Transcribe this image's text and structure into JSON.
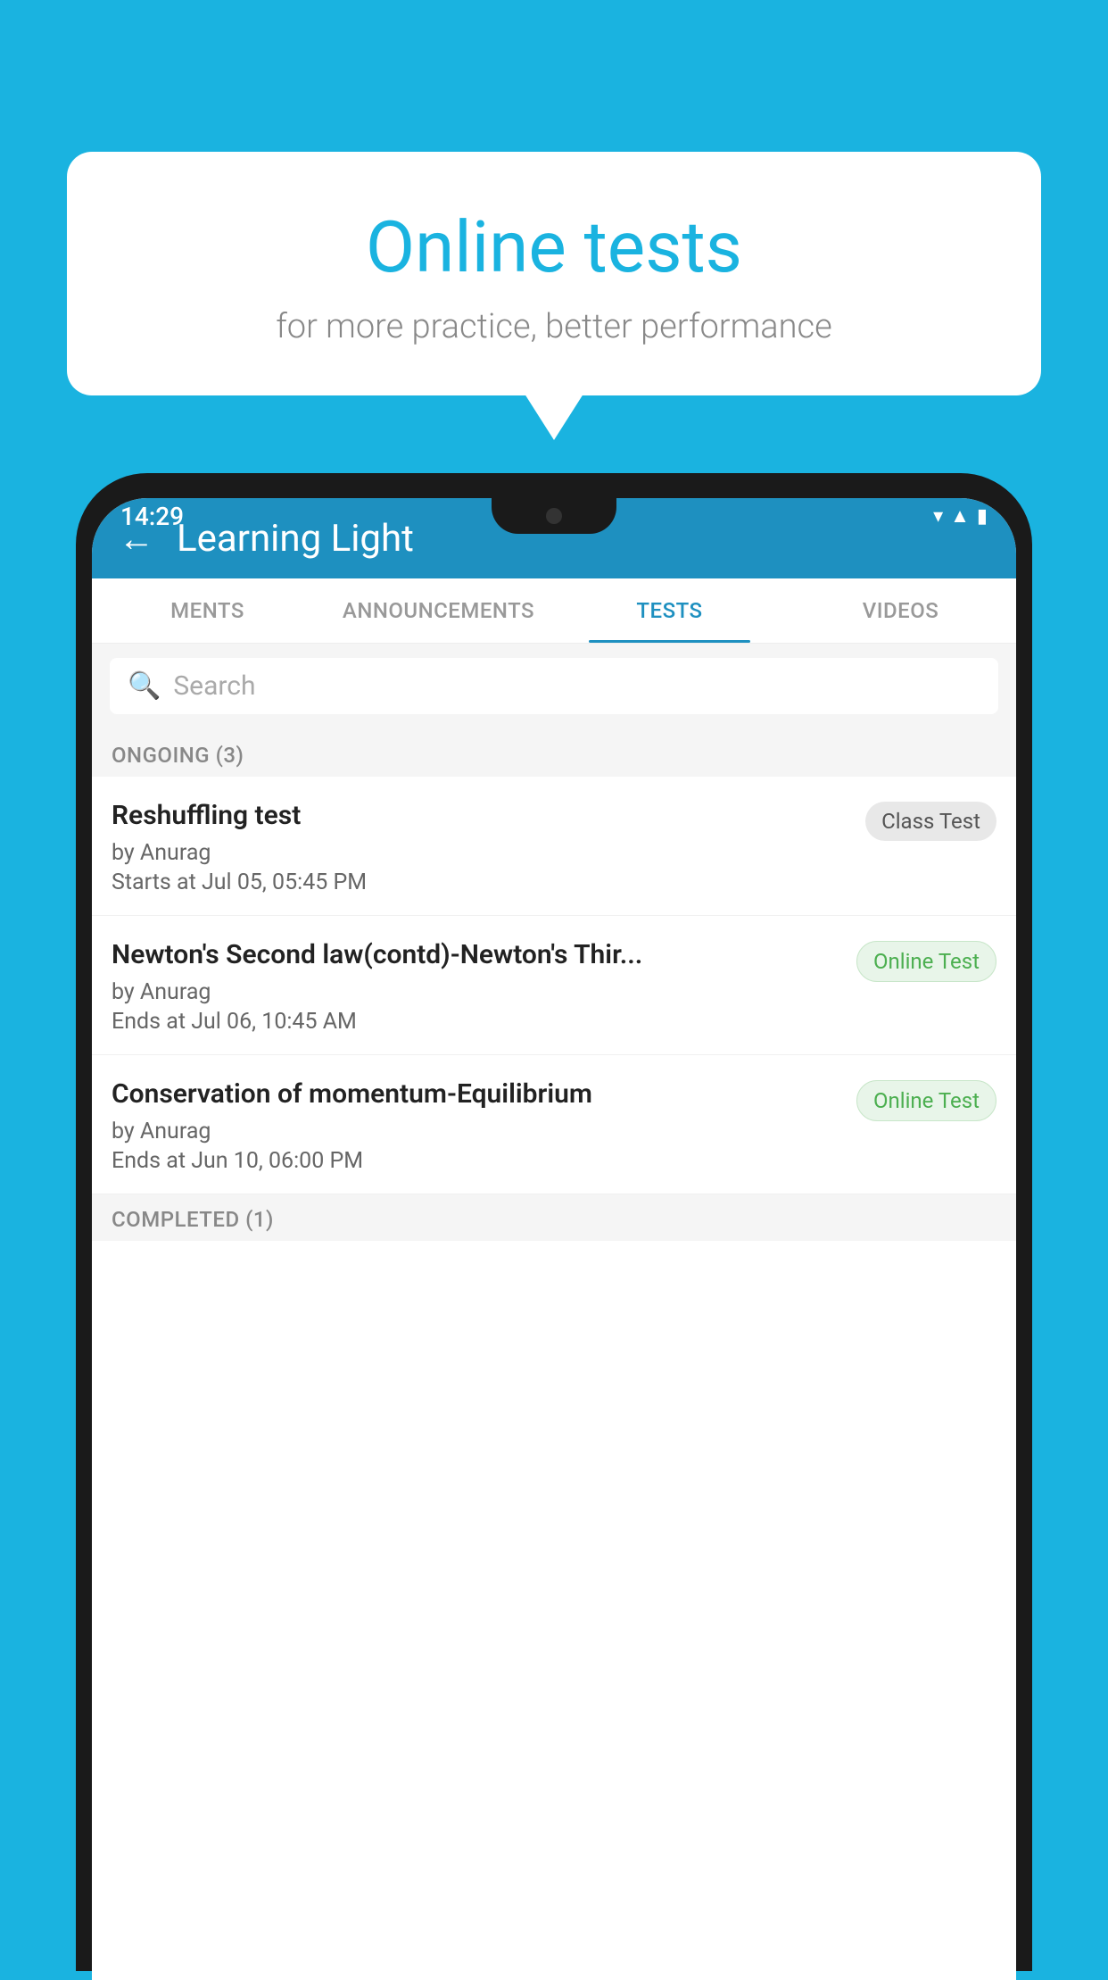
{
  "background_color": "#1ab3e0",
  "speech_bubble": {
    "title": "Online tests",
    "subtitle": "for more practice, better performance"
  },
  "phone": {
    "time": "14:29",
    "app_header": {
      "title": "Learning Light",
      "back_label": "←"
    },
    "tabs": [
      {
        "label": "MENTS",
        "active": false
      },
      {
        "label": "ANNOUNCEMENTS",
        "active": false
      },
      {
        "label": "TESTS",
        "active": true
      },
      {
        "label": "VIDEOS",
        "active": false
      }
    ],
    "search": {
      "placeholder": "Search"
    },
    "ongoing_section": {
      "label": "ONGOING (3)"
    },
    "test_items": [
      {
        "name": "Reshuffling test",
        "author": "by Anurag",
        "date": "Starts at  Jul 05, 05:45 PM",
        "badge": "Class Test",
        "badge_type": "class"
      },
      {
        "name": "Newton's Second law(contd)-Newton's Thir...",
        "author": "by Anurag",
        "date": "Ends at  Jul 06, 10:45 AM",
        "badge": "Online Test",
        "badge_type": "online"
      },
      {
        "name": "Conservation of momentum-Equilibrium",
        "author": "by Anurag",
        "date": "Ends at  Jun 10, 06:00 PM",
        "badge": "Online Test",
        "badge_type": "online"
      }
    ],
    "completed_section": {
      "label": "COMPLETED (1)"
    }
  }
}
